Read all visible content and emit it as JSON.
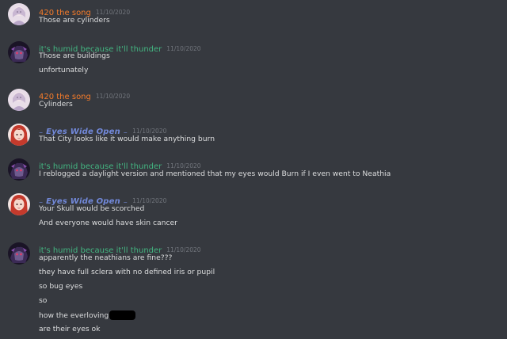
{
  "colors": {
    "background": "#36393f",
    "text": "#dcddde",
    "timestamp": "#72767d",
    "user_420": "#f47b2a",
    "user_humid": "#43b581",
    "user_eyes": "#7289da"
  },
  "messages": [
    {
      "username": "420 the song",
      "timestamp": "11/10/2020",
      "avatar_icon": "girl-avatar-icon",
      "lines": [
        "Those are cylinders"
      ]
    },
    {
      "username": "it's humid because it'll thunder",
      "timestamp": "11/10/2020",
      "avatar_icon": "dark-anime-avatar-icon",
      "lines": [
        "Those are buildings",
        "unfortunately"
      ]
    },
    {
      "username": "420 the song",
      "timestamp": "11/10/2020",
      "avatar_icon": "girl-avatar-icon",
      "lines": [
        "Cylinders"
      ]
    },
    {
      "username": "₋ Eyes Wide Open ₋",
      "timestamp": "11/10/2020",
      "avatar_icon": "red-hair-avatar-icon",
      "lines": [
        "That City looks like it would make anything burn"
      ]
    },
    {
      "username": "it's humid because it'll thunder",
      "timestamp": "11/10/2020",
      "avatar_icon": "dark-anime-avatar-icon",
      "lines": [
        "I reblogged a daylight version and mentioned that my eyes would Burn if I even went to Neathia"
      ]
    },
    {
      "username": "₋ Eyes Wide Open ₋",
      "timestamp": "11/10/2020",
      "avatar_icon": "red-hair-avatar-icon",
      "lines": [
        "Your Skull would be scorched",
        "And everyone would have skin cancer"
      ]
    },
    {
      "username": "it's humid because it'll thunder",
      "timestamp": "11/10/2020",
      "avatar_icon": "dark-anime-avatar-icon",
      "lines": [
        "apparently the neathians are fine???",
        "they have full sclera with no defined iris or pupil",
        "so bug eyes",
        "so",
        "how the everloving",
        "are their eyes ok"
      ]
    }
  ]
}
